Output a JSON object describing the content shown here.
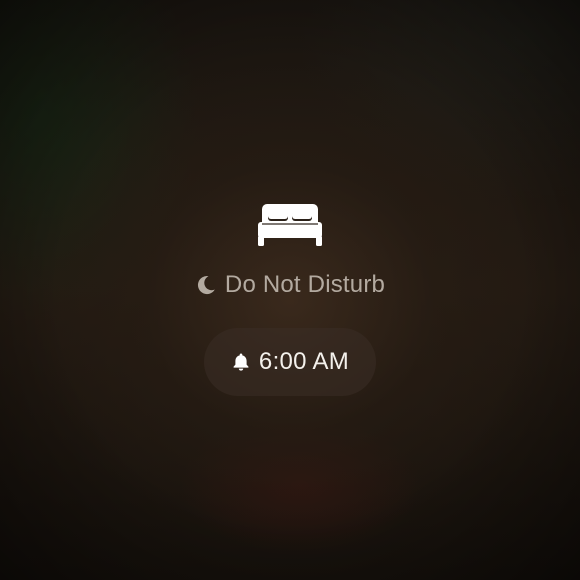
{
  "sleep_mode": {
    "icon": "bed-icon",
    "focus": {
      "icon": "moon-icon",
      "label": "Do Not Disturb"
    },
    "alarm": {
      "icon": "bell-icon",
      "time": "6:00 AM"
    }
  },
  "colors": {
    "label": "#b3aaa0",
    "alarm_text": "#f4f1ec",
    "icon": "#ffffff"
  }
}
